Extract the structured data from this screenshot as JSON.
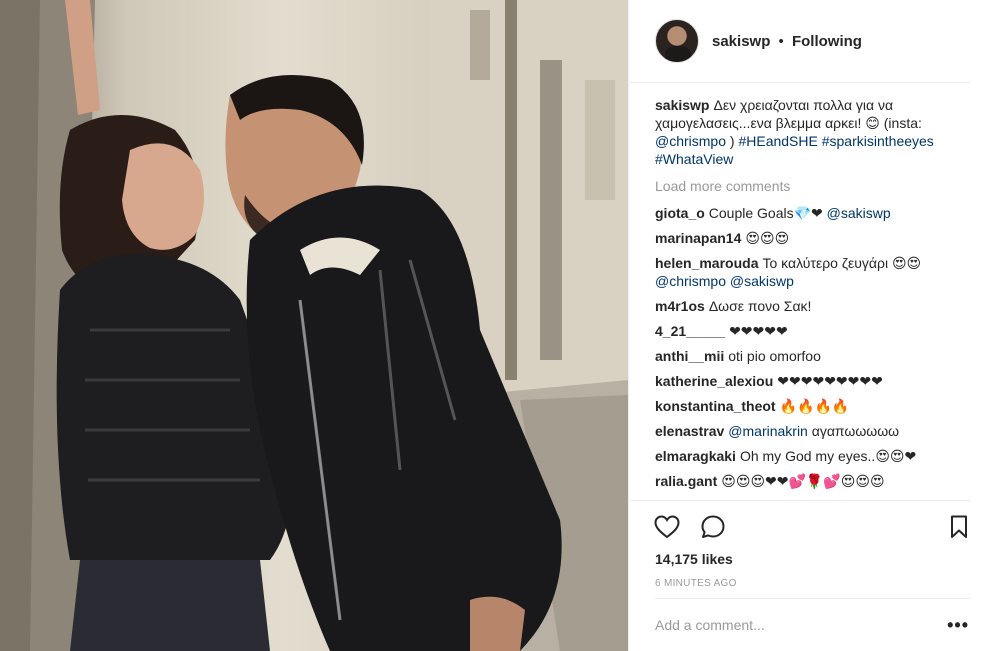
{
  "post": {
    "author": "sakiswp",
    "separator": "•",
    "follow_status": "Following",
    "caption": {
      "user": "sakiswp",
      "text": "Δεν χρειαζονται πολλα για να χαμογελασεις...ενα βλεμμα αρκει! 😊 (insta: ",
      "mention": "@chrismpo",
      "text2": " )",
      "hashtags": "#HEandSHE #sparkisintheeyes #WhataView"
    },
    "load_more": "Load more comments",
    "comments": [
      {
        "user": "giota_o",
        "text": "Couple Goals💎❤ ",
        "mention": "@sakiswp"
      },
      {
        "user": "marinapan14",
        "text": "😍😍😍",
        "mention": ""
      },
      {
        "user": "helen_marouda",
        "text": "Το καλύτερο ζευγάρι 😍😍 ",
        "mention": "@chrismpo @sakiswp"
      },
      {
        "user": "m4r1os",
        "text": "Δωσε πονο Σακ!",
        "mention": ""
      },
      {
        "user": "4_21_____",
        "text": "❤❤❤❤❤",
        "mention": ""
      },
      {
        "user": "anthi__mii",
        "text": "oti pio omorfoo",
        "mention": ""
      },
      {
        "user": "katherine_alexiou",
        "text": "❤❤❤❤❤❤❤❤❤",
        "mention": ""
      },
      {
        "user": "konstantina_theot",
        "text": "🔥🔥🔥🔥",
        "mention": ""
      },
      {
        "user": "elenastrav",
        "text": " αγαπωωωωω",
        "mention": "@marinakrin"
      },
      {
        "user": "elmaragkaki",
        "text": "Oh my God my eyes..😍😍❤",
        "mention": ""
      },
      {
        "user": "ralia.gant",
        "text": "😍😍😍❤❤💕🌹💕😍😍😍",
        "mention": ""
      }
    ],
    "likes": "14,175 likes",
    "time_ago": "6 MINUTES AGO",
    "add_comment_placeholder": "Add a comment...",
    "more_options": "•••"
  },
  "icons": {
    "like": "heart-icon",
    "comment": "speech-bubble-icon",
    "save": "bookmark-icon",
    "more": "more-options-icon"
  },
  "colors": {
    "link": "#003569",
    "muted": "#999999",
    "text": "#262626",
    "divider": "#efefef"
  }
}
